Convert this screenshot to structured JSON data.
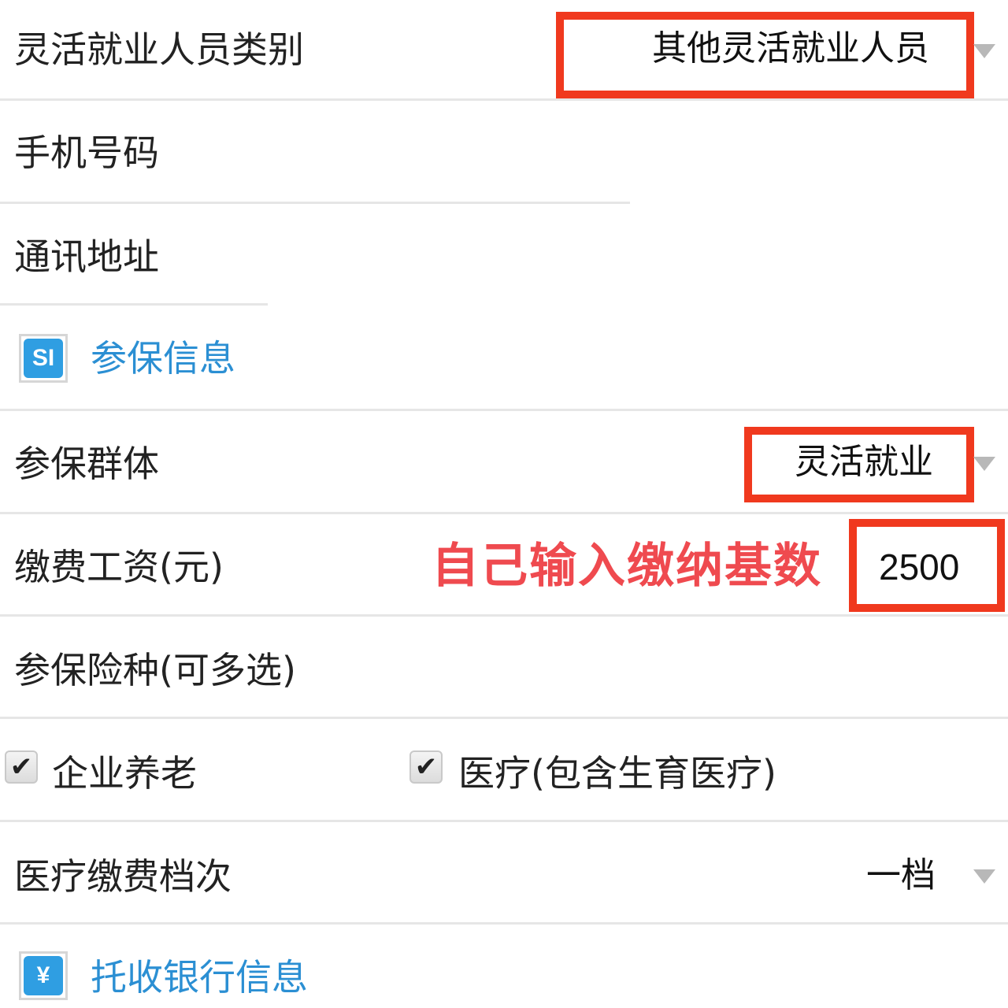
{
  "fields": {
    "employment_type": {
      "label": "灵活就业人员类别",
      "value": "其他灵活就业人员"
    },
    "phone": {
      "label": "手机号码"
    },
    "address": {
      "label": "通讯地址"
    },
    "group": {
      "label": "参保群体",
      "value": "灵活就业"
    },
    "wage": {
      "label": "缴费工资(元)",
      "value": "2500"
    },
    "insurance_types": {
      "label": "参保险种(可多选)"
    },
    "medical_level": {
      "label": "医疗缴费档次",
      "value": "一档"
    }
  },
  "sections": {
    "insurance_info": {
      "icon_text": "SI",
      "icon": "si-icon",
      "title": "参保信息"
    },
    "bank_info": {
      "icon_text": "¥",
      "icon": "yen-icon",
      "title": "托收银行信息"
    }
  },
  "checkboxes": [
    {
      "label": "企业养老",
      "checked": true
    },
    {
      "label": "医疗(包含生育医疗)",
      "checked": true
    }
  ],
  "annotation": {
    "text": "自己输入缴纳基数"
  },
  "colors": {
    "highlight": "#f0391e",
    "annotation": "#ef4a4f",
    "section_title": "#2b8fd3",
    "icon_bg": "#2f9ee2"
  }
}
